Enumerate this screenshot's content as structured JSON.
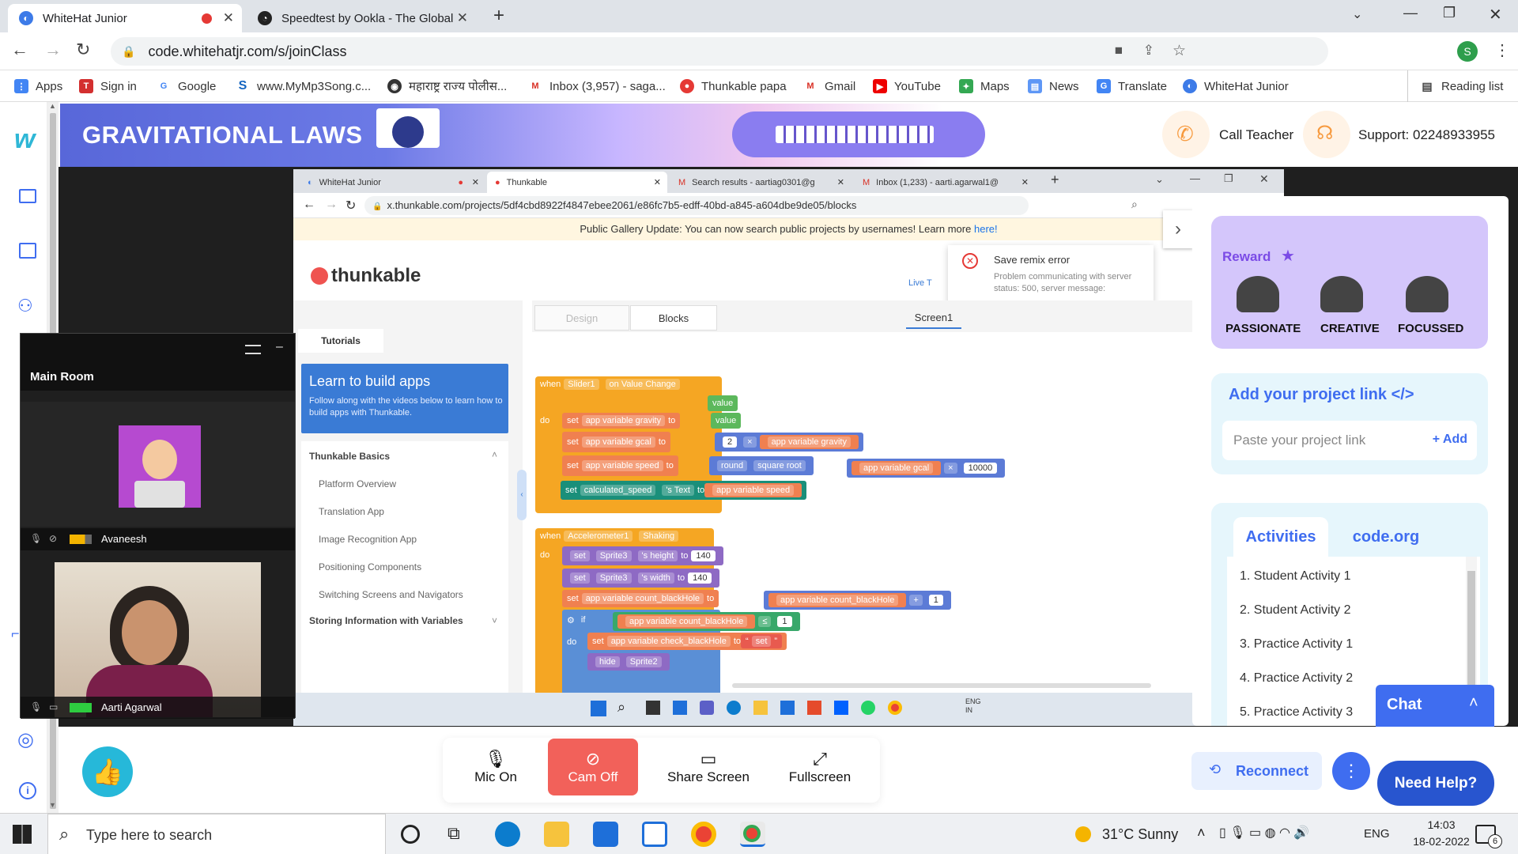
{
  "browser": {
    "tabs": [
      {
        "title": "WhiteHat Junior",
        "recording": true
      },
      {
        "title": "Speedtest by Ookla - The Global"
      }
    ],
    "url": "code.whitehatjr.com/s/joinClass",
    "profile_initial": "S",
    "bookmarks": [
      "Apps",
      "Sign in",
      "Google",
      "www.MyMp3Song.c...",
      "महाराष्ट्र राज्य पोलीस...",
      "Inbox (3,957) - saga...",
      "Thunkable papa",
      "Gmail",
      "YouTube",
      "Maps",
      "News",
      "Translate",
      "WhiteHat Junior"
    ],
    "reading_list": "Reading list"
  },
  "header": {
    "class_title": "GRAVITATIONAL LAWS",
    "call_teacher": "Call Teacher",
    "support": "Support: 02248933955"
  },
  "shared_screen": {
    "tabs": [
      "WhiteHat Junior",
      "Thunkable",
      "Search results - aartiag0301@g",
      "Inbox (1,233) - aarti.agarwal1@"
    ],
    "url": "x.thunkable.com/projects/5df4cbd8922f4847ebee2061/e86fc7b5-edff-40bd-a845-a604dbe9de05/blocks",
    "notice": "Public Gallery Update: You can now search public projects by usernames! Learn more",
    "notice_link": "here!",
    "logo": "thunkable",
    "error_title": "Save remix error",
    "error_body": "Problem communicating with server status: 500, server message:",
    "live_test": "Live T",
    "tabs_editor": {
      "design": "Design",
      "blocks": "Blocks",
      "screen": "Screen1"
    },
    "tutorials_tab": "Tutorials",
    "learn_title": "Learn to build apps",
    "learn_body": "Follow along with the videos below to learn how to build apps with Thunkable.",
    "section_basics": "Thunkable Basics",
    "basics_items": [
      "Platform Overview",
      "Translation App",
      "Image Recognition App",
      "Positioning Components",
      "Switching Screens and Navigators"
    ],
    "section_storing": "Storing Information with Variables",
    "blocks": {
      "when": "when",
      "do": "do",
      "set": "set",
      "to": "to",
      "value": "value",
      "if": "if",
      "slider": "Slider1",
      "on_change": "on Value Change",
      "gravity": "app variable gravity",
      "gcal": "app variable gcal",
      "speed": "app variable speed",
      "n2": "2",
      "op_mul": "×",
      "round": "round",
      "sqrt": "square root",
      "n10000": "10000",
      "calc_speed": "calculated_speed",
      "s_text": "'s Text",
      "accel": "Accelerometer1",
      "shaking": "Shaking",
      "sprite3": "Sprite3",
      "height": "'s height",
      "width": "'s width",
      "n140": "140",
      "count": "app variable count_blackHole",
      "plus": "+",
      "n1": "1",
      "lte": "≤",
      "check": "app variable check_blackHole",
      "set_str": "set",
      "hide": "hide",
      "sprite2": "Sprite2"
    },
    "taskbar_lang": [
      "ENG",
      "IN"
    ]
  },
  "participants": {
    "room": "Main Room",
    "people": [
      {
        "name": "Avaneesh"
      },
      {
        "name": "Aarti Agarwal"
      }
    ]
  },
  "reward": {
    "title": "Reward",
    "badges": [
      "PASSIONATE",
      "CREATIVE",
      "FOCUSSED"
    ]
  },
  "project_link": {
    "title": "Add your project link </>",
    "placeholder": "Paste your project link",
    "add": "+ Add"
  },
  "activities": {
    "tabs": [
      "Activities",
      "code.org"
    ],
    "items": [
      "1. Student Activity 1",
      "2. Student Activity 2",
      "3. Practice Activity 1",
      "4. Practice Activity 2",
      "5. Practice Activity 3"
    ]
  },
  "chat": "Chat",
  "controls": {
    "mic": "Mic On",
    "cam": "Cam Off",
    "share": "Share Screen",
    "fullscreen": "Fullscreen",
    "reconnect": "Reconnect",
    "need_help": "Need Help?"
  },
  "taskbar": {
    "search_placeholder": "Type here to search",
    "weather": "31°C  Sunny",
    "lang": "ENG",
    "time": "14:03",
    "date": "18-02-2022",
    "notif_count": "6"
  },
  "colors": {
    "header_blue": "#5c6bdf",
    "accent_blue": "#3f6df0",
    "cam_red": "#f2615a",
    "reward_purple": "#d4c6fb",
    "block_orange": "#f5a623"
  }
}
